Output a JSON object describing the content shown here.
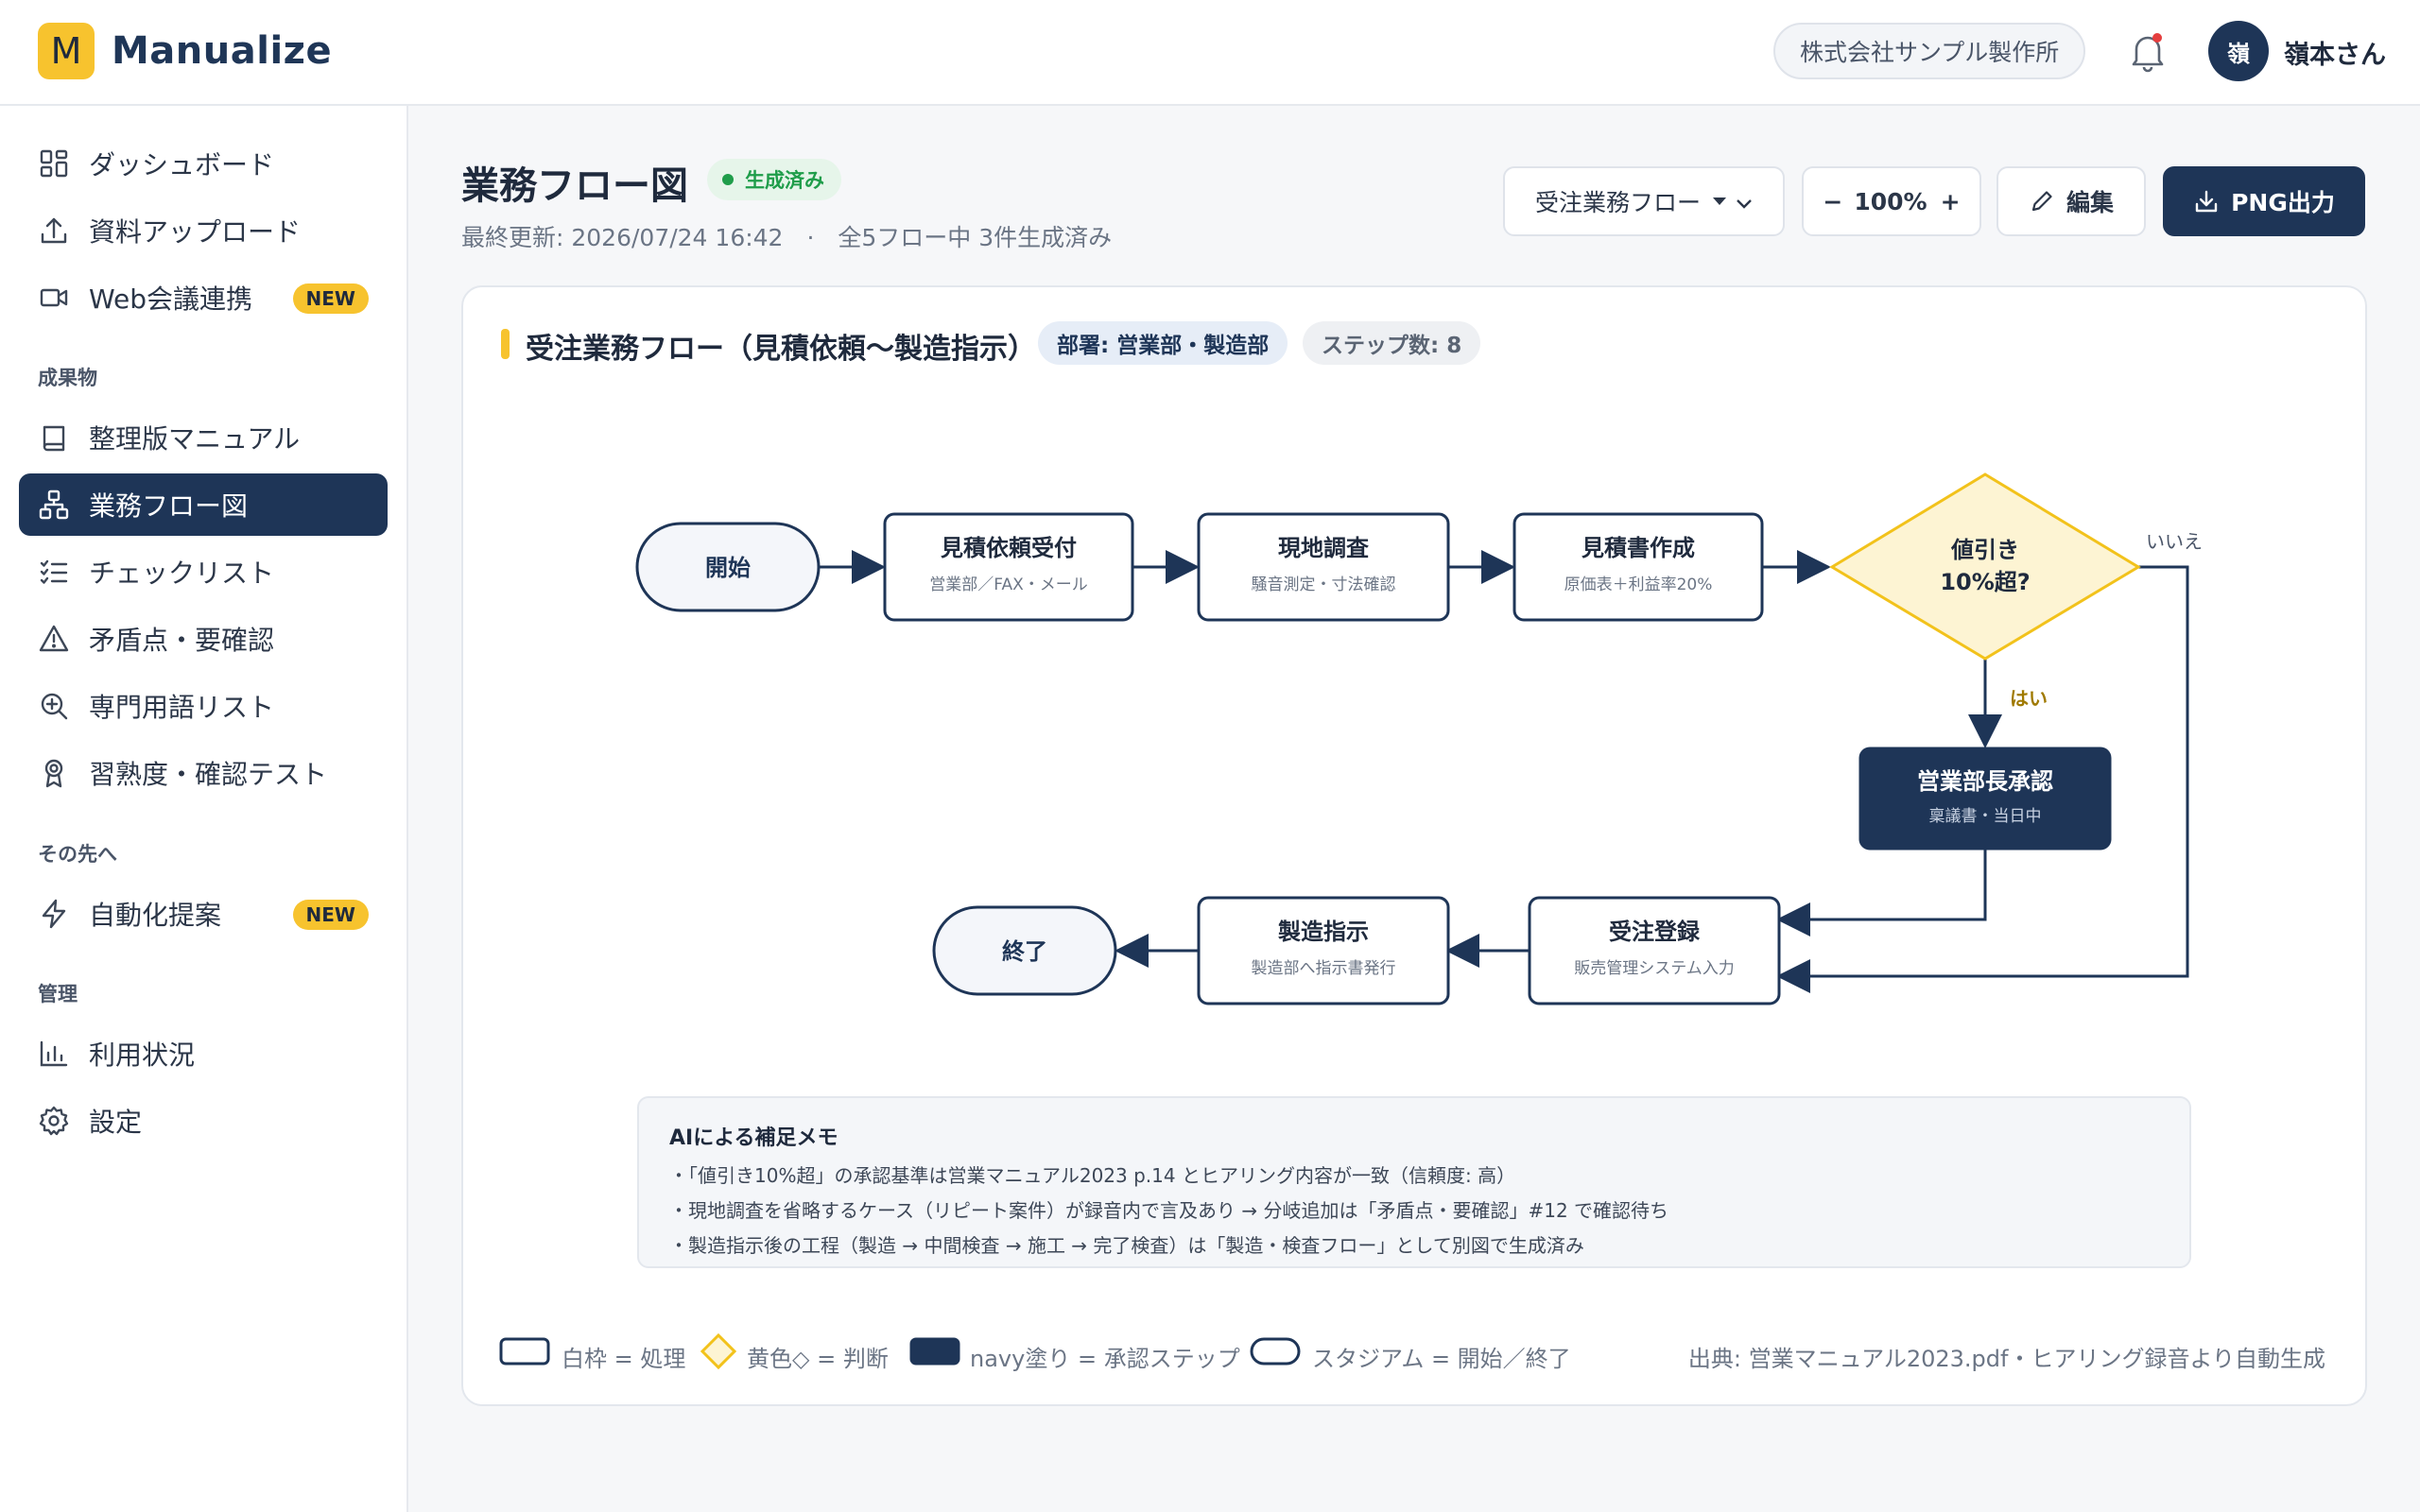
{
  "app": {
    "logo_letter": "M",
    "name": "Manualize"
  },
  "header": {
    "company": "株式会社サンプル製作所",
    "avatar_initial": "嶺",
    "user_name": "嶺本さん"
  },
  "sidebar": {
    "items": [
      {
        "label": "ダッシュボード",
        "icon": "dashboard-icon"
      },
      {
        "label": "資料アップロード",
        "icon": "upload-icon"
      },
      {
        "label": "Web会議連携",
        "icon": "video-icon",
        "badge": "NEW"
      }
    ],
    "section_outputs": "成果物",
    "outputs": [
      {
        "label": "整理版マニュアル",
        "icon": "book-icon"
      },
      {
        "label": "業務フロー図",
        "icon": "flow-icon",
        "active": true
      },
      {
        "label": "チェックリスト",
        "icon": "checklist-icon"
      },
      {
        "label": "矛盾点・要確認",
        "icon": "warning-icon"
      },
      {
        "label": "専門用語リスト",
        "icon": "search-plus-icon"
      },
      {
        "label": "習熟度・確認テスト",
        "icon": "award-icon"
      }
    ],
    "section_next": "その先へ",
    "next": [
      {
        "label": "自動化提案",
        "icon": "bolt-icon",
        "badge": "NEW"
      }
    ],
    "section_admin": "管理",
    "admin": [
      {
        "label": "利用状況",
        "icon": "chart-icon"
      },
      {
        "label": "設定",
        "icon": "gear-icon"
      }
    ]
  },
  "page": {
    "title": "業務フロー図",
    "status": "生成済み",
    "meta": "最終更新: 2026/07/24 16:42　·　全5フロー中 3件生成済み",
    "flow_select": "受注業務フロー",
    "zoom": "100%",
    "edit_label": "編集",
    "export_label": "PNG出力"
  },
  "card": {
    "title": "受注業務フロー（見積依頼〜製造指示）",
    "dept_tag": "部署: 営業部・製造部",
    "steps_tag": "ステップ数: 8"
  },
  "flow": {
    "start": "開始",
    "n1_title": "見積依頼受付",
    "n1_sub": "営業部／FAX・メール",
    "n2_title": "現地調査",
    "n2_sub": "騒音測定・寸法確認",
    "n3_title": "見積書作成",
    "n3_sub": "原価表＋利益率20%",
    "decision_line1": "値引き",
    "decision_line2": "10%超?",
    "no_label": "いいえ",
    "yes_label": "はい",
    "approve_title": "営業部長承認",
    "approve_sub": "稟議書・当日中",
    "order_title": "受注登録",
    "order_sub": "販売管理システム入力",
    "mfg_title": "製造指示",
    "mfg_sub": "製造部へ指示書発行",
    "end": "終了"
  },
  "memo": {
    "title": "AIによる補足メモ",
    "lines": [
      "・「値引き10%超」の承認基準は営業マニュアル2023 p.14 とヒアリング内容が一致（信頼度: 高）",
      "・現地調査を省略するケース（リピート案件）が録音内で言及あり → 分岐追加は「矛盾点・要確認」#12 で確認待ち",
      "・製造指示後の工程（製造 → 中間検査 → 施工 → 完了検査）は「製造・検査フロー」として別図で生成済み"
    ]
  },
  "legend": {
    "process": "白枠 = 処理",
    "decision": "黄色◇ = 判断",
    "approval": "navy塗り = 承認ステップ",
    "terminal": "スタジアム = 開始／終了",
    "source": "出典: 営業マニュアル2023.pdf・ヒアリング録音より自動生成"
  },
  "colors": {
    "navy": "#1e3557",
    "yellow": "#f7c32e",
    "decision_fill": "#fdf4d3",
    "green": "#1f9d4a"
  }
}
